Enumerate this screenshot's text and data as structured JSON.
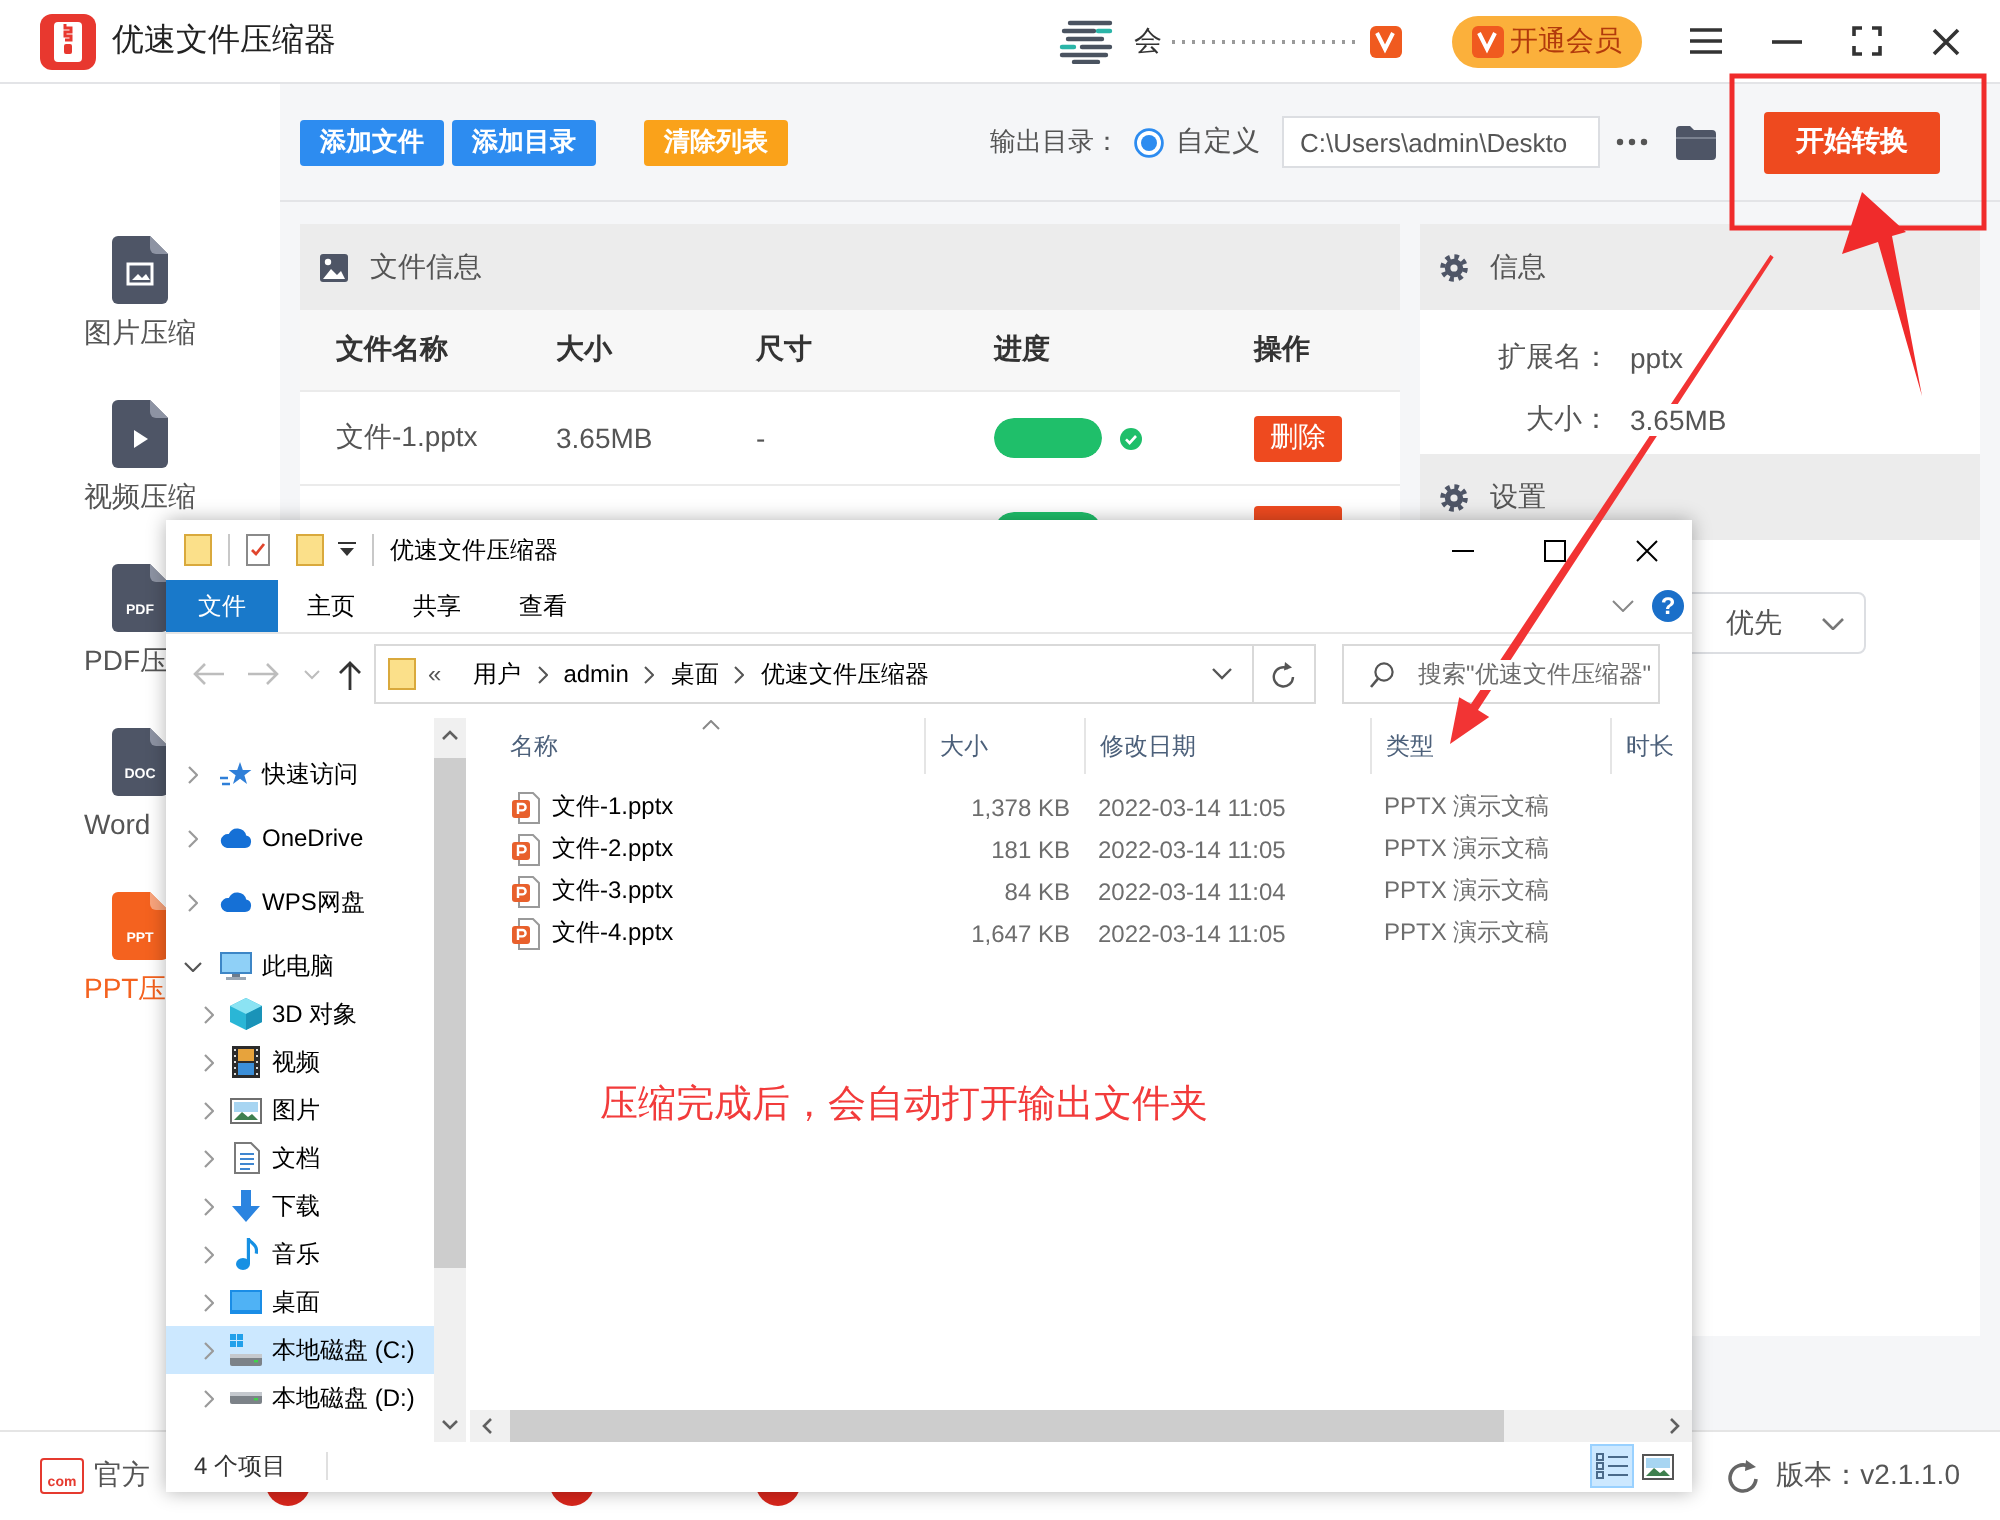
{
  "app": {
    "title": "优速文件压缩器",
    "user_name": "会",
    "vip_button": "开通会员"
  },
  "sidebar": {
    "items": [
      {
        "kind": "image",
        "label": "图片压缩",
        "selected": false
      },
      {
        "kind": "video",
        "label": "视频压缩",
        "selected": false
      },
      {
        "kind": "document",
        "icon_text": "PDF",
        "label": "PDF压",
        "selected": false
      },
      {
        "kind": "document",
        "icon_text": "DOC",
        "label": "Word",
        "selected": false
      },
      {
        "kind": "document",
        "icon_text": "PPT",
        "label": "PPT压",
        "selected": true
      }
    ]
  },
  "toolbar": {
    "buttons": [
      {
        "kind": "primary",
        "label": "添加文件"
      },
      {
        "kind": "primary",
        "label": "添加目录"
      },
      {
        "kind": "warning",
        "label": "清除列表"
      }
    ],
    "output_label": "输出目录：",
    "output_mode": {
      "label": "自定义",
      "selected": true
    },
    "output_path": "C:\\Users\\admin\\Deskto",
    "start_button": "开始转换"
  },
  "file_panel": {
    "title": "文件信息",
    "columns": [
      "文件名称",
      "大小",
      "尺寸",
      "进度",
      "操作"
    ],
    "rows": [
      {
        "name": "文件-1.pptx",
        "size": "3.65MB",
        "dimensions": "-",
        "level": 1,
        "done": true,
        "action": "删除"
      },
      {
        "level": 1
      }
    ]
  },
  "info_panel": {
    "title": "信息",
    "fields": [
      {
        "label": "扩展名：",
        "value": "pptx"
      },
      {
        "label": "大小：",
        "value": "3.65MB"
      }
    ]
  },
  "settings_panel": {
    "title": "设置",
    "dropdown_value": "优先"
  },
  "footer": {
    "website_badge": "com",
    "website": "官方",
    "version": "版本：v2.1.1.0"
  },
  "explorer": {
    "title": "优速文件压缩器",
    "ribbon_tabs": [
      {
        "label": "文件",
        "selected": true
      },
      {
        "label": "主页",
        "selected": false
      },
      {
        "label": "共享",
        "selected": false
      },
      {
        "label": "查看",
        "selected": false
      }
    ],
    "help": "?",
    "breadcrumb_overflow": "«",
    "breadcrumb": [
      "用户",
      "admin",
      "桌面",
      "优速文件压缩器"
    ],
    "search": {
      "placeholder": "搜索\"优速文件压缩器\""
    },
    "nav": [
      {
        "kind": "star",
        "label": "快速访问",
        "expanded": false,
        "selected": false
      },
      {
        "kind": "cloud",
        "label": "OneDrive",
        "expanded": false,
        "selected": false
      },
      {
        "kind": "cloud",
        "label": "WPS网盘",
        "expanded": false,
        "selected": false
      },
      {
        "kind": "computer",
        "label": "此电脑",
        "expanded": true,
        "selected": false,
        "children": [
          {
            "kind": "cube",
            "label": "3D 对象",
            "expanded": false,
            "selected": false
          },
          {
            "kind": "film",
            "label": "视频",
            "expanded": false,
            "selected": false
          },
          {
            "kind": "picture",
            "label": "图片",
            "expanded": false,
            "selected": false
          },
          {
            "kind": "document",
            "label": "文档",
            "expanded": false,
            "selected": false
          },
          {
            "kind": "download",
            "label": "下载",
            "expanded": false,
            "selected": false
          },
          {
            "kind": "music",
            "label": "音乐",
            "expanded": false,
            "selected": false
          },
          {
            "kind": "desktop",
            "label": "桌面",
            "expanded": false,
            "selected": false
          },
          {
            "kind": "system-drive",
            "label": "本地磁盘 (C:)",
            "expanded": false,
            "selected": true
          },
          {
            "kind": "drive",
            "label": "本地磁盘 (D:)",
            "expanded": false,
            "selected": false
          }
        ]
      }
    ],
    "columns": [
      {
        "label": "名称",
        "sorted": true
      },
      {
        "label": "大小",
        "sorted": false
      },
      {
        "label": "修改日期",
        "sorted": false
      },
      {
        "label": "类型",
        "sorted": false
      },
      {
        "label": "时长",
        "sorted": false
      }
    ],
    "files": [
      {
        "name": "文件-1.pptx",
        "size": "1,378 KB",
        "modified": "2022-03-14 11:05",
        "type": "PPTX 演示文稿"
      },
      {
        "name": "文件-2.pptx",
        "size": "181 KB",
        "modified": "2022-03-14 11:05",
        "type": "PPTX 演示文稿"
      },
      {
        "name": "文件-3.pptx",
        "size": "84 KB",
        "modified": "2022-03-14 11:04",
        "type": "PPTX 演示文稿"
      },
      {
        "name": "文件-4.pptx",
        "size": "1,647 KB",
        "modified": "2022-03-14 11:05",
        "type": "PPTX 演示文稿"
      }
    ],
    "status": "4 个项目",
    "views": [
      {
        "kind": "details",
        "selected": true
      },
      {
        "kind": "thumbnails",
        "selected": false
      }
    ]
  },
  "annotation": "压缩完成后，会自动打开输出文件夹"
}
